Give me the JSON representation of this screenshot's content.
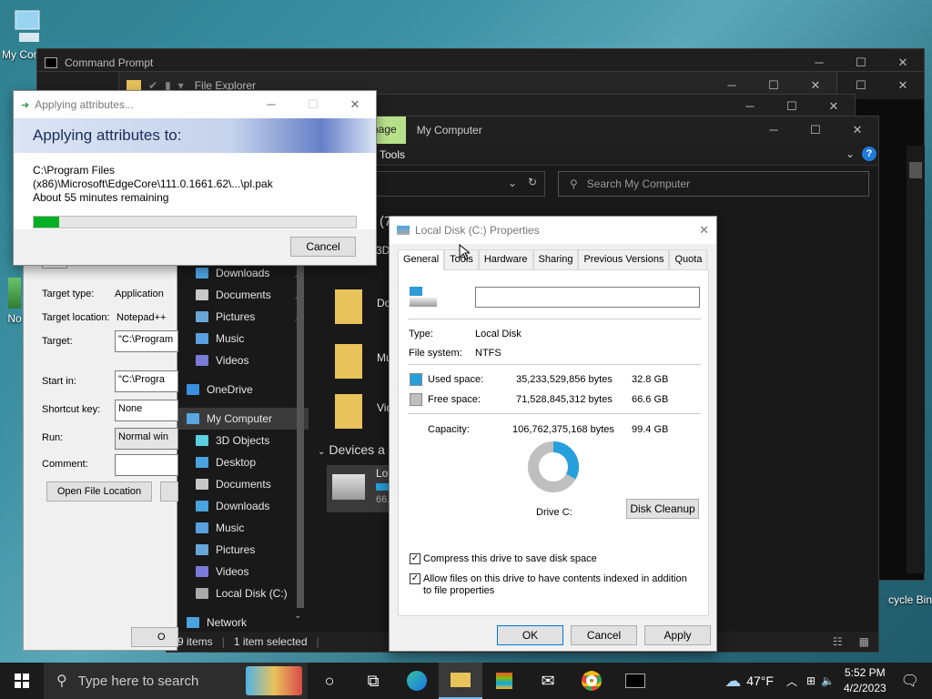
{
  "desktop": {
    "icon1_label": "My Comp",
    "icon2_label": "No",
    "icon3_label": "cycle Bin"
  },
  "cmd_window": {
    "title": "Command Prompt"
  },
  "explorer": {
    "title": "File Explorer",
    "tab_manage": "nage",
    "tab_location": "My Computer",
    "ribbon_tools": "Tools",
    "search_placeholder": "Search My Computer",
    "nav": [
      {
        "label": "Downloads"
      },
      {
        "label": "Documents"
      },
      {
        "label": "Pictures"
      },
      {
        "label": "Music"
      },
      {
        "label": "Videos"
      },
      {
        "label": "OneDrive"
      },
      {
        "label": "My Computer"
      },
      {
        "label": "3D Objects"
      },
      {
        "label": "Desktop"
      },
      {
        "label": "Documents"
      },
      {
        "label": "Downloads"
      },
      {
        "label": "Music"
      },
      {
        "label": "Pictures"
      },
      {
        "label": "Videos"
      },
      {
        "label": "Local Disk (C:)"
      },
      {
        "label": "Network"
      }
    ],
    "content_labels": [
      "Do",
      "Mu",
      "Vid",
      "Lo",
      "66."
    ],
    "section_header": "Devices a",
    "header_partial": "(7",
    "header_partial2": "3D",
    "status_items": "9 items",
    "status_selected": "1 item selected"
  },
  "shortcut_props": {
    "target_type_label": "Target type:",
    "target_type_value": "Application",
    "target_location_label": "Target location:",
    "target_location_value": "Notepad++",
    "target_label": "Target:",
    "target_value": "\"C:\\Program",
    "start_in_label": "Start in:",
    "start_in_value": "\"C:\\Progra",
    "shortcut_key_label": "Shortcut key:",
    "shortcut_key_value": "None",
    "run_label": "Run:",
    "run_value": "Normal win",
    "comment_label": "Comment:",
    "open_file_location": "Open File Location",
    "ok_partial": "O"
  },
  "applying": {
    "title": "Applying attributes...",
    "header": "Applying attributes to:",
    "path": "C:\\Program Files (x86)\\Microsoft\\EdgeCore\\111.0.1661.62\\...\\pl.pak",
    "remaining": "About 55 minutes remaining",
    "progress_pct": 8,
    "cancel": "Cancel"
  },
  "ld_props": {
    "title": "Local Disk (C:) Properties",
    "tabs": [
      "General",
      "Tools",
      "Hardware",
      "Sharing",
      "Previous Versions",
      "Quota"
    ],
    "type_label": "Type:",
    "type_value": "Local Disk",
    "fs_label": "File system:",
    "fs_value": "NTFS",
    "used_label": "Used space:",
    "used_bytes": "35,233,529,856 bytes",
    "used_gb": "32.8 GB",
    "free_label": "Free space:",
    "free_bytes": "71,528,845,312 bytes",
    "free_gb": "66.6 GB",
    "capacity_label": "Capacity:",
    "capacity_bytes": "106,762,375,168 bytes",
    "capacity_gb": "99.4 GB",
    "drive_label": "Drive C:",
    "disk_cleanup": "Disk Cleanup",
    "compress_label": "Compress this drive to save disk space",
    "index_label": "Allow files on this drive to have contents indexed in addition to file properties",
    "ok": "OK",
    "cancel": "Cancel",
    "apply": "Apply",
    "used_fraction": 0.33,
    "used_color": "#26a0da",
    "free_color": "#bfbfbf"
  },
  "taskbar": {
    "search_placeholder": "Type here to search",
    "weather": "47°F",
    "time": "5:52 PM",
    "date": "4/2/2023"
  }
}
